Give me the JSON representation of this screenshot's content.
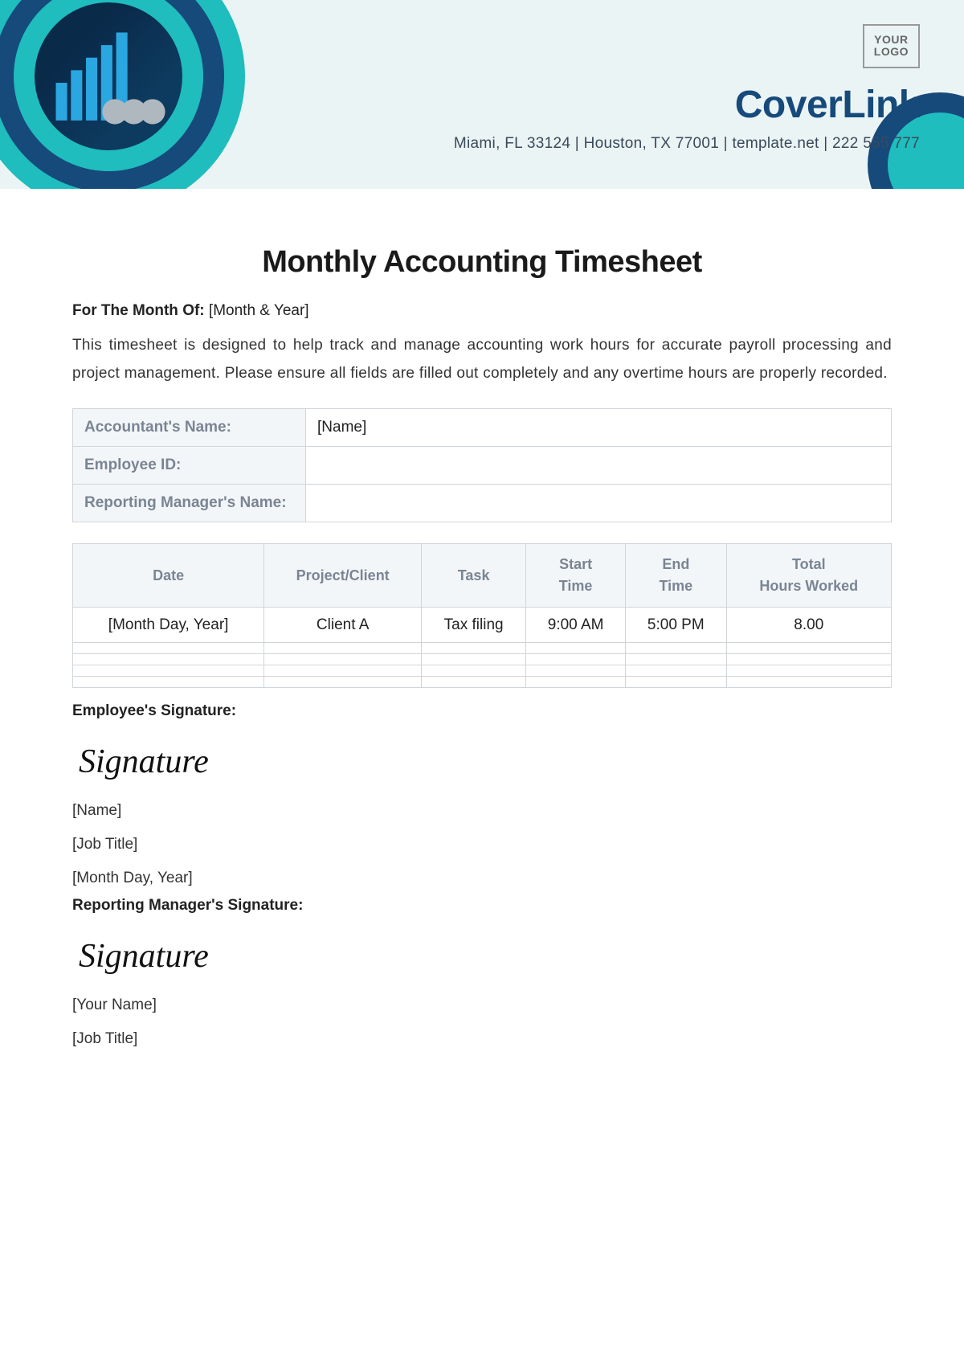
{
  "header": {
    "logo_text_line1": "YOUR",
    "logo_text_line2": "LOGO",
    "company_name": "CoverLink",
    "company_info": "Miami, FL 33124 | Houston, TX 77001 | template.net | 222 555 777"
  },
  "title": "Monthly Accounting Timesheet",
  "month_label": "For The Month Of:",
  "month_value": "[Month & Year]",
  "description": "This timesheet is designed to help track and manage accounting work hours for accurate payroll processing and project management. Please ensure all fields are filled out completely and any overtime hours are properly recorded.",
  "info_table": {
    "rows": [
      {
        "label": "Accountant's Name:",
        "value": "[Name]"
      },
      {
        "label": "Employee ID:",
        "value": ""
      },
      {
        "label": "Reporting Manager's Name:",
        "value": ""
      }
    ]
  },
  "time_table": {
    "headers": [
      "Date",
      "Project/Client",
      "Task",
      "Start Time",
      "End Time",
      "Total Hours Worked"
    ],
    "rows": [
      {
        "date": "[Month Day, Year]",
        "project": "Client A",
        "task": "Tax filing",
        "start": "9:00 AM",
        "end": "5:00 PM",
        "total": "8.00"
      }
    ]
  },
  "employee_sig": {
    "label": "Employee's Signature:",
    "signature": "Signature",
    "name": "[Name]",
    "job_title": "[Job Title]",
    "date": "[Month Day, Year]"
  },
  "manager_sig": {
    "label": "Reporting Manager's Signature:",
    "signature": "Signature",
    "name": "[Your Name]",
    "job_title": "[Job Title]"
  }
}
